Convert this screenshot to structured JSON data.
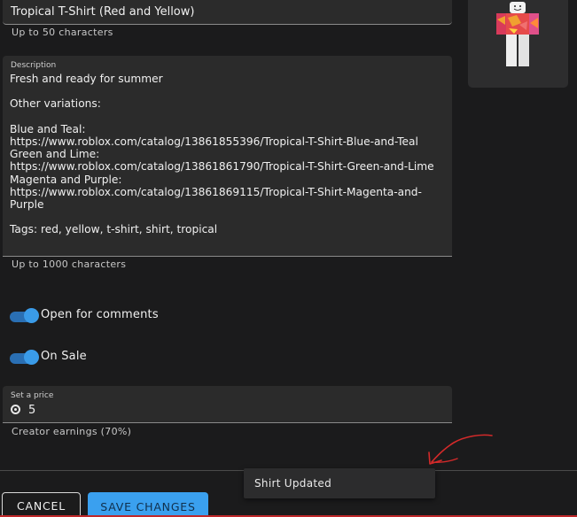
{
  "form": {
    "name": {
      "value": "Tropical T-Shirt (Red and Yellow)",
      "helper": "Up to 50 characters"
    },
    "description": {
      "label": "Description",
      "value": "Fresh and ready for summer\n\nOther variations:\n\nBlue and Teal:\nhttps://www.roblox.com/catalog/13861855396/Tropical-T-Shirt-Blue-and-Teal\nGreen and Lime:\nhttps://www.roblox.com/catalog/13861861790/Tropical-T-Shirt-Green-and-Lime\nMagenta and Purple:\nhttps://www.roblox.com/catalog/13861869115/Tropical-T-Shirt-Magenta-and-Purple\n\nTags: red, yellow, t-shirt, shirt, tropical",
      "helper": "Up to 1000 characters"
    },
    "toggles": {
      "comments": {
        "label": "Open for comments",
        "on": true
      },
      "on_sale": {
        "label": "On Sale",
        "on": true
      }
    },
    "price": {
      "label": "Set a price",
      "value": "5",
      "icon": "robux-icon",
      "helper": "Creator earnings (70%)"
    }
  },
  "preview": {
    "icon": "avatar-shirt-preview"
  },
  "toast": {
    "message": "Shirt Updated"
  },
  "footer": {
    "cancel_label": "CANCEL",
    "save_label": "SAVE CHANGES"
  },
  "colors": {
    "background": "#1b1b1c",
    "field": "#2b2b2b",
    "accent": "#3aa0ef",
    "annotation": "#d42a2a"
  }
}
